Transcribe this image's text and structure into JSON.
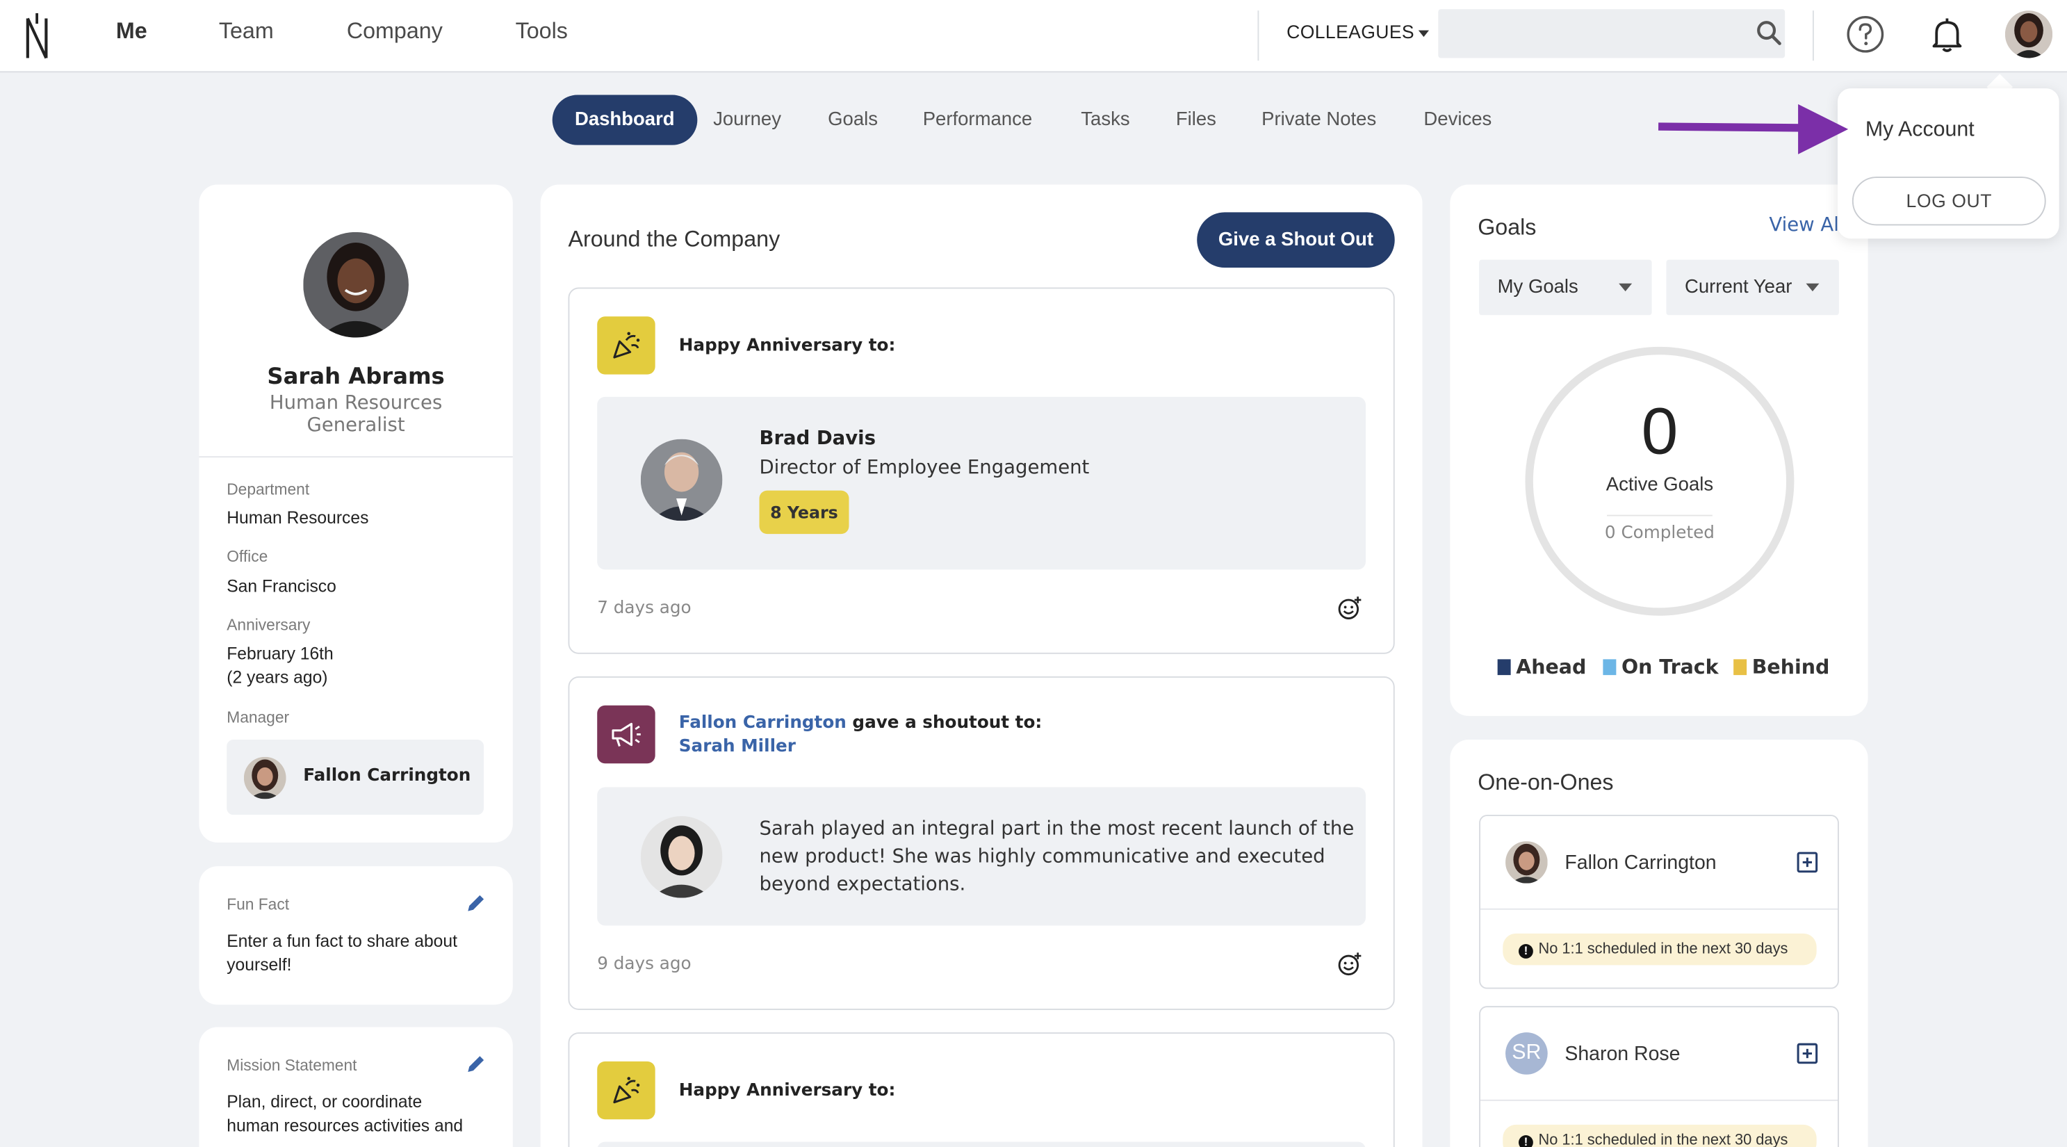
{
  "topbar": {
    "nav": [
      "Me",
      "Team",
      "Company",
      "Tools"
    ],
    "colleagues_label": "COLLEAGUES",
    "search_placeholder": ""
  },
  "tabs": [
    "Dashboard",
    "Journey",
    "Goals",
    "Performance",
    "Tasks",
    "Files",
    "Private Notes",
    "Devices"
  ],
  "profile": {
    "name": "Sarah Abrams",
    "title_line1": "Human Resources",
    "title_line2": "Generalist",
    "department_label": "Department",
    "department": "Human Resources",
    "office_label": "Office",
    "office": "San Francisco",
    "anniversary_label": "Anniversary",
    "anniversary": "February 16th",
    "anniversary_ago": "(2 years ago)",
    "manager_label": "Manager",
    "manager_name": "Fallon Carrington"
  },
  "fun_fact": {
    "label": "Fun Fact",
    "text_line1": "Enter a fun fact to share about",
    "text_line2": "yourself!"
  },
  "mission": {
    "label": "Mission Statement",
    "text_line1": "Plan, direct, or coordinate",
    "text_line2": "human resources activities and"
  },
  "feed": {
    "title": "Around the Company",
    "shout_button": "Give a Shout Out",
    "items": [
      {
        "heading": "Happy Anniversary to:",
        "person_name": "Brad Davis",
        "person_title": "Director of Employee Engagement",
        "badge": "8 Years",
        "time": "7 days ago"
      },
      {
        "giver": "Fallon Carrington",
        "action": " gave a shoutout to:",
        "receiver": "Sarah Miller",
        "message_line1": "Sarah played an integral part in the most recent launch of the",
        "message_line2": "new product! She was highly communicative and executed",
        "message_line3": "beyond expectations.",
        "time": "9 days ago"
      },
      {
        "heading": "Happy Anniversary to:"
      }
    ]
  },
  "goals": {
    "title": "Goals",
    "view_all": "View All",
    "filter1": "My Goals",
    "filter2": "Current Year",
    "count": "0",
    "count_label": "Active Goals",
    "completed": "0 Completed",
    "legend": [
      {
        "label": "Ahead",
        "color": "#253d6b"
      },
      {
        "label": "On Track",
        "color": "#6cb6e6"
      },
      {
        "label": "Behind",
        "color": "#e8c045"
      }
    ]
  },
  "one_on_ones": {
    "title": "One-on-Ones",
    "items": [
      {
        "name": "Fallon Carrington",
        "initials": "",
        "warning": "No 1:1 scheduled in the next 30 days"
      },
      {
        "name": "Sharon Rose",
        "initials": "SR",
        "warning": "No 1:1 scheduled in the next 30 days"
      }
    ]
  },
  "account_menu": {
    "my_account": "My Account",
    "logout": "LOG OUT"
  },
  "colors": {
    "primary": "#253d6b",
    "link": "#3a64a8",
    "annotation_arrow": "#7b2fa8",
    "anniversary_icon": "#e3cc3e",
    "shoutout_icon": "#7a3457"
  }
}
